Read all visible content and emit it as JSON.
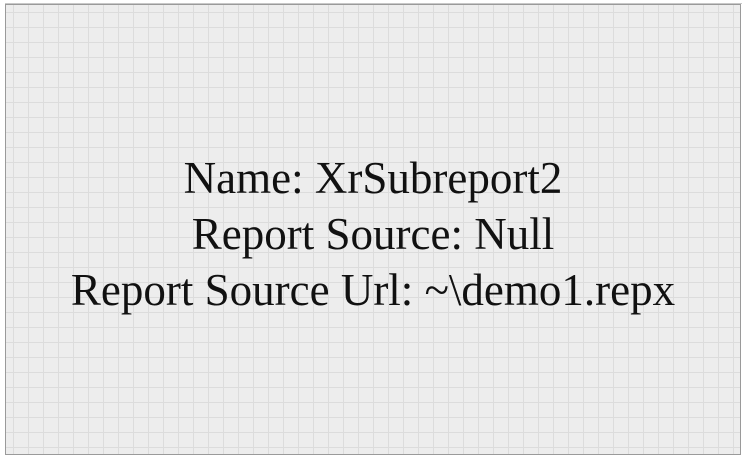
{
  "subreport": {
    "name_line": "Name: XrSubreport2",
    "source_line": "Report Source: Null",
    "url_line": "Report Source Url: ~\\demo1.repx"
  }
}
